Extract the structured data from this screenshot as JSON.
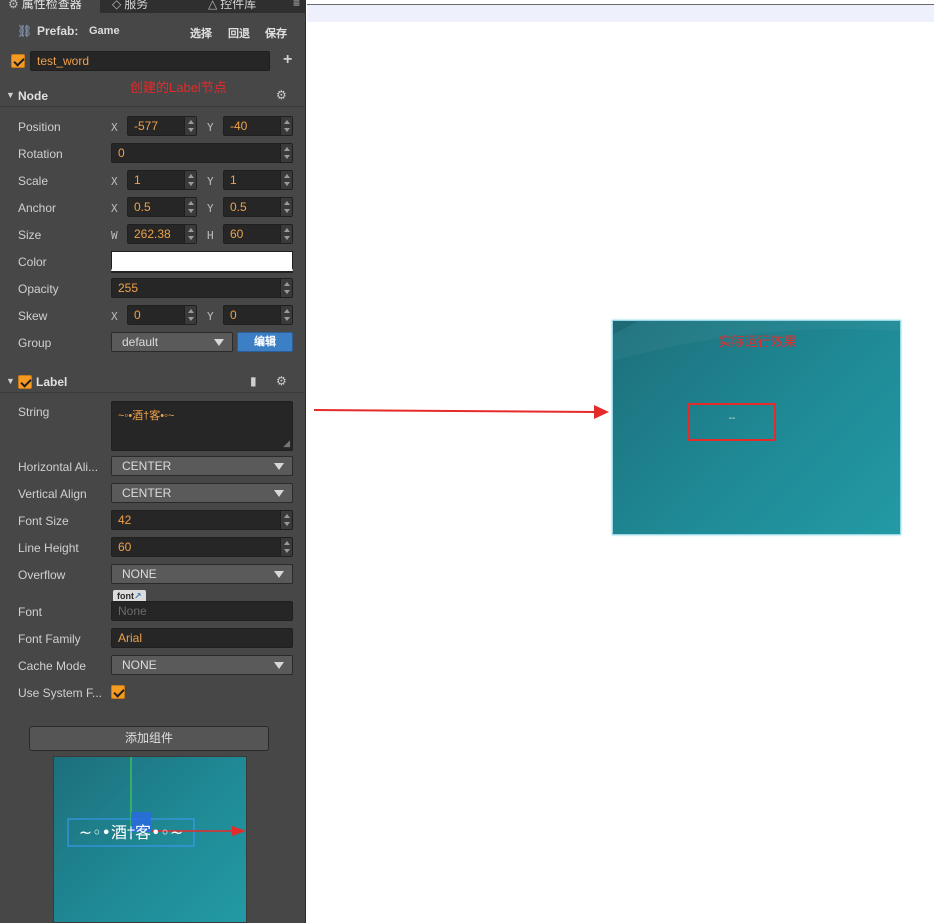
{
  "tabs": [
    {
      "icon": "gear-icon",
      "label": "属性检查器"
    },
    {
      "icon": "service-icon",
      "label": "服务"
    },
    {
      "icon": "controls-icon",
      "label": "控件库"
    }
  ],
  "prefab": {
    "label": "Prefab:",
    "name": "Game",
    "select": "选择",
    "revert": "回退",
    "save": "保存"
  },
  "node_name": "test_word",
  "annotation_top": "创建的Label节点",
  "node": {
    "title": "Node",
    "position": {
      "label": "Position",
      "x": "-577",
      "y": "-40"
    },
    "rotation": {
      "label": "Rotation",
      "value": "0"
    },
    "scale": {
      "label": "Scale",
      "x": "1",
      "y": "1"
    },
    "anchor": {
      "label": "Anchor",
      "x": "0.5",
      "y": "0.5"
    },
    "size": {
      "label": "Size",
      "w": "262.38",
      "h": "60"
    },
    "color": {
      "label": "Color",
      "value": "#ffffff"
    },
    "opacity": {
      "label": "Opacity",
      "value": "255"
    },
    "skew": {
      "label": "Skew",
      "x": "0",
      "y": "0"
    },
    "group": {
      "label": "Group",
      "value": "default",
      "edit": "编辑"
    }
  },
  "axis": {
    "x": "X",
    "y": "Y",
    "w": "W",
    "h": "H"
  },
  "label": {
    "title": "Label",
    "string": {
      "label": "String",
      "value": "~◦•酒†客•◦~"
    },
    "horizontal_align": {
      "label": "Horizontal Ali...",
      "value": "CENTER"
    },
    "vertical_align": {
      "label": "Vertical Align",
      "value": "CENTER"
    },
    "font_size": {
      "label": "Font Size",
      "value": "42"
    },
    "line_height": {
      "label": "Line Height",
      "value": "60"
    },
    "overflow": {
      "label": "Overflow",
      "value": "NONE"
    },
    "font": {
      "label": "Font",
      "tag": "font",
      "value": "None"
    },
    "font_family": {
      "label": "Font Family",
      "value": "Arial"
    },
    "cache_mode": {
      "label": "Cache Mode",
      "value": "NONE"
    },
    "use_system_font": {
      "label": "Use System F..."
    }
  },
  "add_component": "添加组件",
  "preview_text": "~◦•酒†客•◦~",
  "game_view": {
    "caption": "实际运行效果",
    "text": "--"
  },
  "colors": {
    "accent": "#f59a23",
    "annotation": "#e52a2a",
    "game_bg": "#1f8a95"
  }
}
